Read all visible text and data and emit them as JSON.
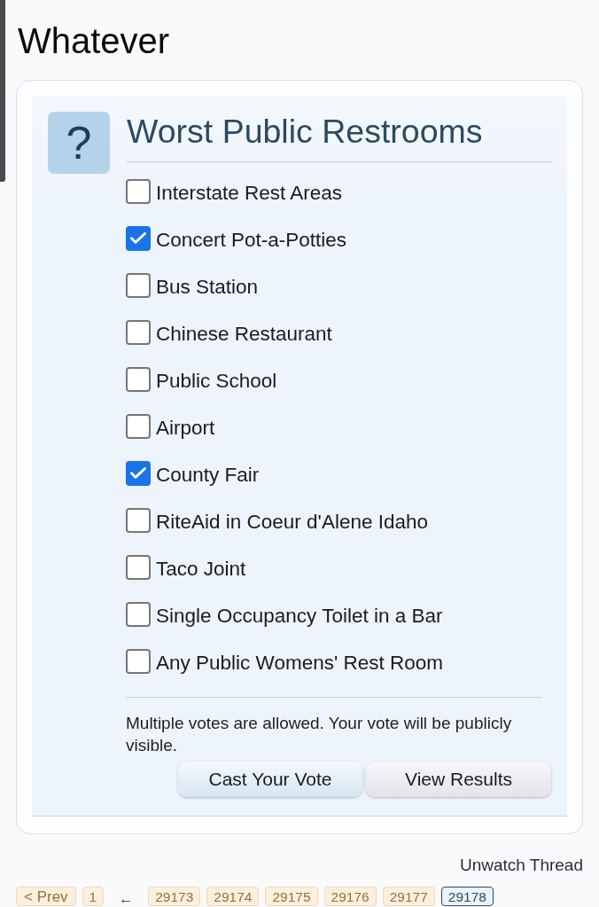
{
  "page": {
    "title": "Whatever"
  },
  "poll": {
    "icon": "?",
    "title": "Worst Public Restrooms",
    "options": [
      {
        "label": "Interstate Rest Areas",
        "checked": false
      },
      {
        "label": "Concert Pot-a-Potties",
        "checked": true
      },
      {
        "label": "Bus Station",
        "checked": false
      },
      {
        "label": "Chinese Restaurant",
        "checked": false
      },
      {
        "label": "Public School",
        "checked": false
      },
      {
        "label": "Airport",
        "checked": false
      },
      {
        "label": "County Fair",
        "checked": true
      },
      {
        "label": "RiteAid in Coeur d'Alene Idaho",
        "checked": false
      },
      {
        "label": "Taco Joint",
        "checked": false
      },
      {
        "label": "Single Occupancy Toilet in a Bar",
        "checked": false
      },
      {
        "label": "Any Public Womens' Rest Room",
        "checked": false
      }
    ],
    "note": "Multiple votes are allowed. Your vote will be publicly visible.",
    "buttons": [
      {
        "label": "Cast Your Vote",
        "kind": "primary"
      },
      {
        "label": "View Results",
        "kind": "secondary"
      }
    ]
  },
  "thread_links": {
    "unwatch": "Unwatch Thread"
  },
  "pagination": {
    "prev": "< Prev",
    "items": [
      {
        "kind": "page",
        "label": "1",
        "selected": false
      },
      {
        "kind": "separator",
        "label": "←"
      },
      {
        "kind": "page",
        "label": "29173",
        "selected": false
      },
      {
        "kind": "page",
        "label": "29174",
        "selected": false
      },
      {
        "kind": "page",
        "label": "29175",
        "selected": false
      },
      {
        "kind": "page",
        "label": "29176",
        "selected": false
      },
      {
        "kind": "page",
        "label": "29177",
        "selected": false
      },
      {
        "kind": "page",
        "label": "29178",
        "selected": true
      }
    ]
  }
}
